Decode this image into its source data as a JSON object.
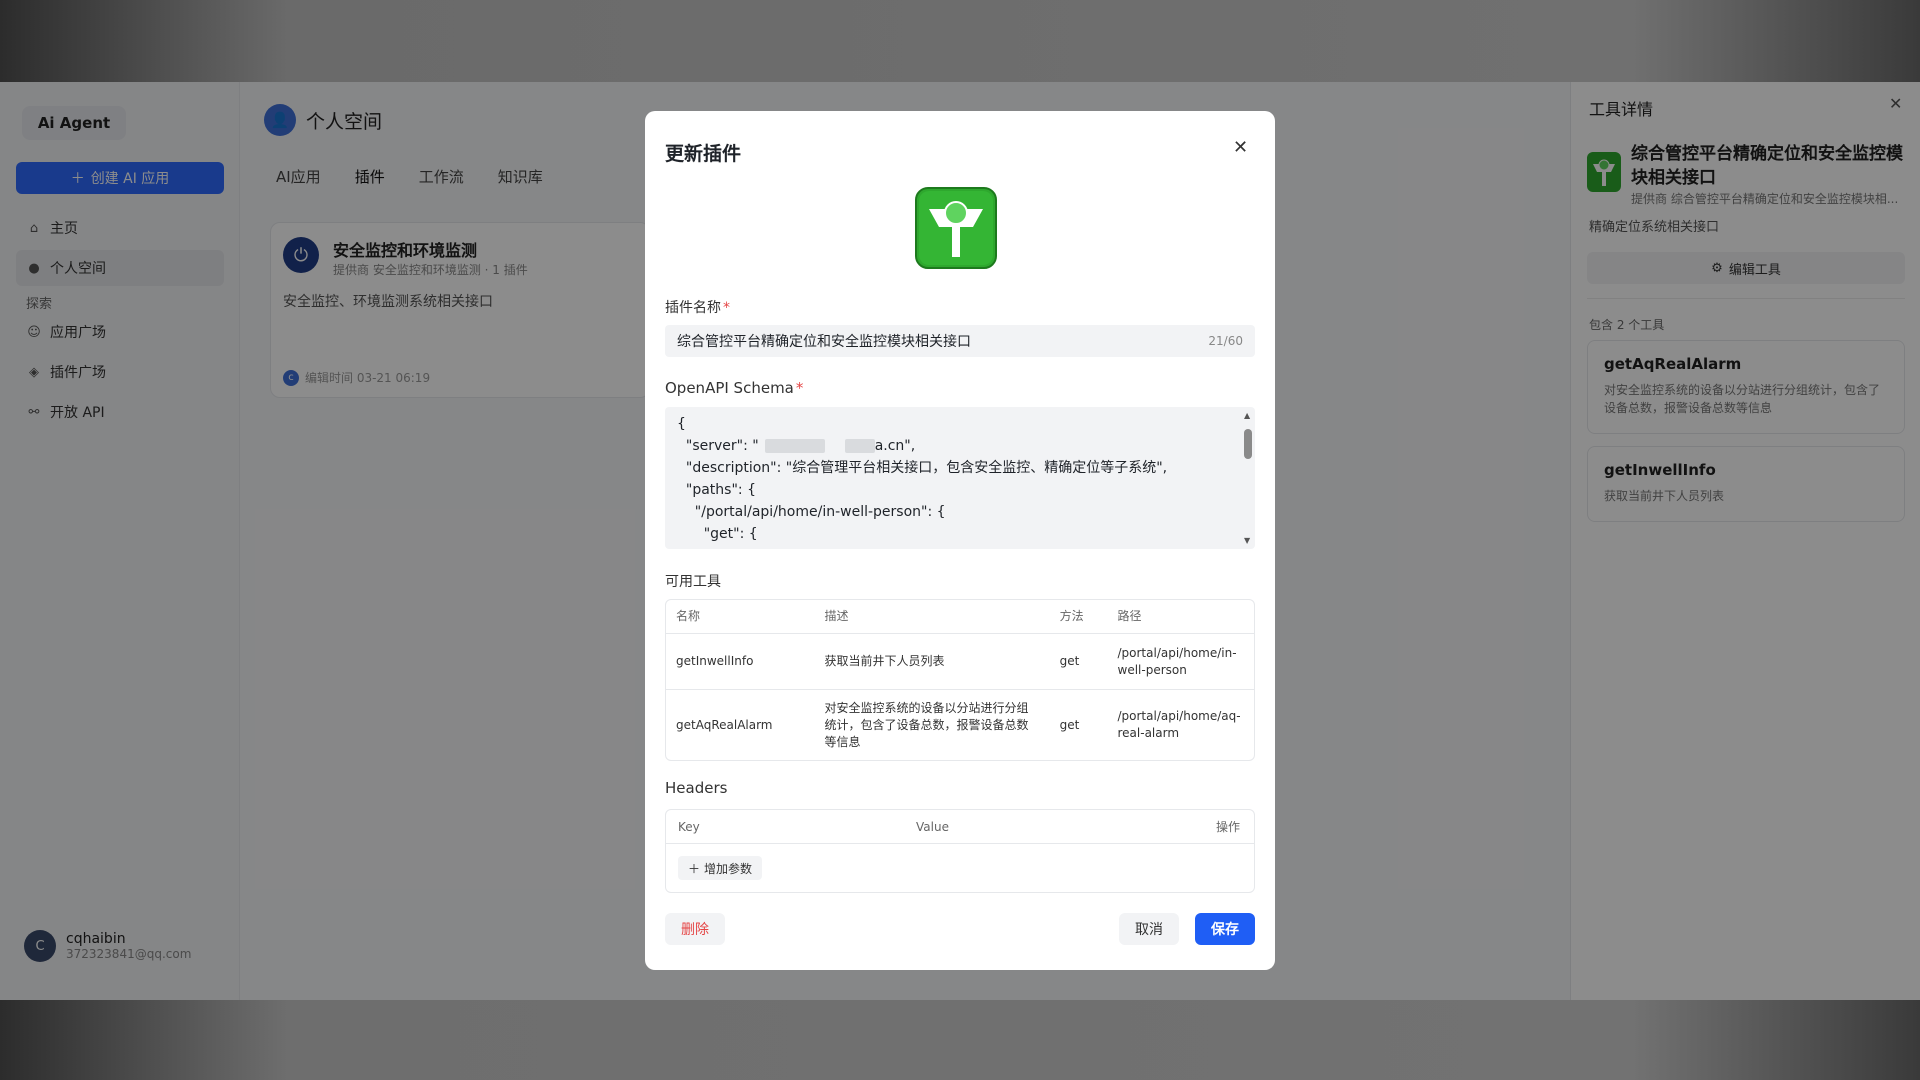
{
  "sidebar": {
    "brand": "Ai Agent",
    "create_label": "创建 AI 应用",
    "items": [
      {
        "label": "主页",
        "icon": "home-icon"
      },
      {
        "label": "个人空间",
        "icon": "user-icon"
      }
    ],
    "group_label": "探索",
    "explore_items": [
      {
        "label": "应用广场",
        "icon": "smile-icon"
      },
      {
        "label": "插件广场",
        "icon": "cube-icon"
      },
      {
        "label": "开放 API",
        "icon": "share-icon"
      }
    ],
    "user": {
      "avatar": "C",
      "name": "cqhaibin",
      "email": "372323841@qq.com"
    }
  },
  "main": {
    "title": "个人空间",
    "tabs": [
      "AI应用",
      "插件",
      "工作流",
      "知识库"
    ],
    "card": {
      "title": "安全监控和环境监测",
      "subtitle": "提供商 安全监控和环境监测 · 1 插件",
      "description": "安全监控、环境监测系统相关接口",
      "footer": "编辑时间 03-21 06:19"
    }
  },
  "right_panel": {
    "header": "工具详情",
    "title": "综合管控平台精确定位和安全监控模块相关接口",
    "provider": "提供商 综合管控平台精确定位和安全监控模块相...",
    "description": "精确定位系统相关接口",
    "edit_label": "编辑工具",
    "count_label": "包含 2 个工具",
    "tools": [
      {
        "name": "getAqRealAlarm",
        "description": "对安全监控系统的设备以分站进行分组统计，包含了设备总数，报警设备总数等信息"
      },
      {
        "name": "getInwellInfo",
        "description": "获取当前井下人员列表"
      }
    ]
  },
  "modal": {
    "title": "更新插件",
    "name_label": "插件名称",
    "name_value": "综合管控平台精确定位和安全监控模块相关接口",
    "name_count": "21/60",
    "schema_label": "OpenAPI Schema",
    "schema_lines": [
      "{",
      "  \"server\": \"",
      "  \"description\": \"综合管理平台相关接口，包含安全监控、精确定位等子系统\",",
      "  \"paths\": {",
      "    \"/portal/api/home/in-well-person\": {",
      "      \"get\": {"
    ],
    "server_suffix": "a.cn\",",
    "tools_label": "可用工具",
    "table_headers": [
      "名称",
      "描述",
      "方法",
      "路径"
    ],
    "table_rows": [
      {
        "name": "getInwellInfo",
        "desc": "获取当前井下人员列表",
        "method": "get",
        "path": "/portal/api/home/in-well-person"
      },
      {
        "name": "getAqRealAlarm",
        "desc": "对安全监控系统的设备以分站进行分组统计，包含了设备总数，报警设备总数等信息",
        "method": "get",
        "path": "/portal/api/home/aq-real-alarm"
      }
    ],
    "headers_label": "Headers",
    "headers_cols": [
      "Key",
      "Value",
      "操作"
    ],
    "add_param_label": "增加参数",
    "delete_label": "删除",
    "cancel_label": "取消",
    "save_label": "保存"
  },
  "colors": {
    "primary": "#1f5ef5",
    "danger": "#e54545",
    "logo_green": "#2ea82e"
  }
}
